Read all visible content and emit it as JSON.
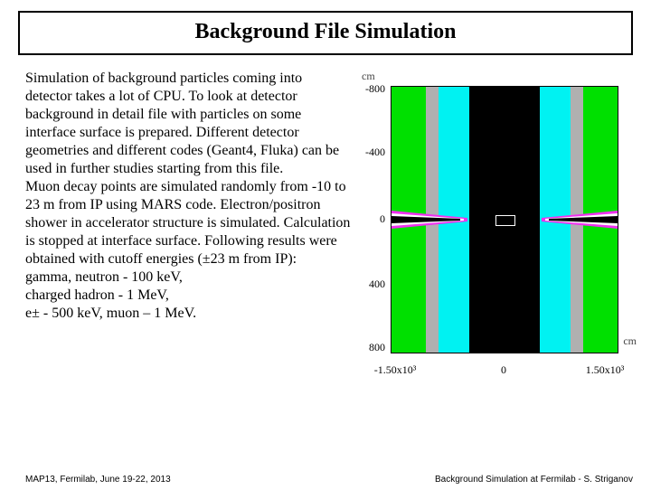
{
  "title": "Background File Simulation",
  "paragraph": "Simulation of background particles coming into detector takes a lot of CPU. To look at detector background in detail file with particles on some interface surface is prepared. Different detector geometries and different codes (Geant4, Fluka) can be used in further studies starting from this file.\nMuon decay points are simulated randomly from -10 to 23 m from IP using MARS code. Electron/positron shower in accelerator structure is simulated. Calculation is stopped at interface surface. Following results were obtained with cutoff energies (±23 m from IP):\ngamma, neutron - 100 keV,\ncharged hadron - 1 MeV,\ne± - 500 keV, muon – 1 MeV.",
  "footer": {
    "left": "MAP13, Fermilab, June 19-22, 2013",
    "right": "Background Simulation at Fermilab - S. Striganov"
  },
  "chart_data": {
    "type": "diagram",
    "title": "",
    "x_unit": "cm",
    "y_unit": "cm",
    "y_ticks": [
      "-800",
      "-400",
      "0",
      "400",
      "800"
    ],
    "x_ticks": [
      "-1.50x10³",
      "0",
      "1.50x10³"
    ],
    "xlim": [
      -1500,
      1500
    ],
    "ylim": [
      -800,
      800
    ],
    "note": "Cross-section of detector geometry (MARS) showing green hall, cyan calorimeter/yoke region, black inner absorber, grey side walls, and beamline cones meeting at IP (y≈0)."
  }
}
